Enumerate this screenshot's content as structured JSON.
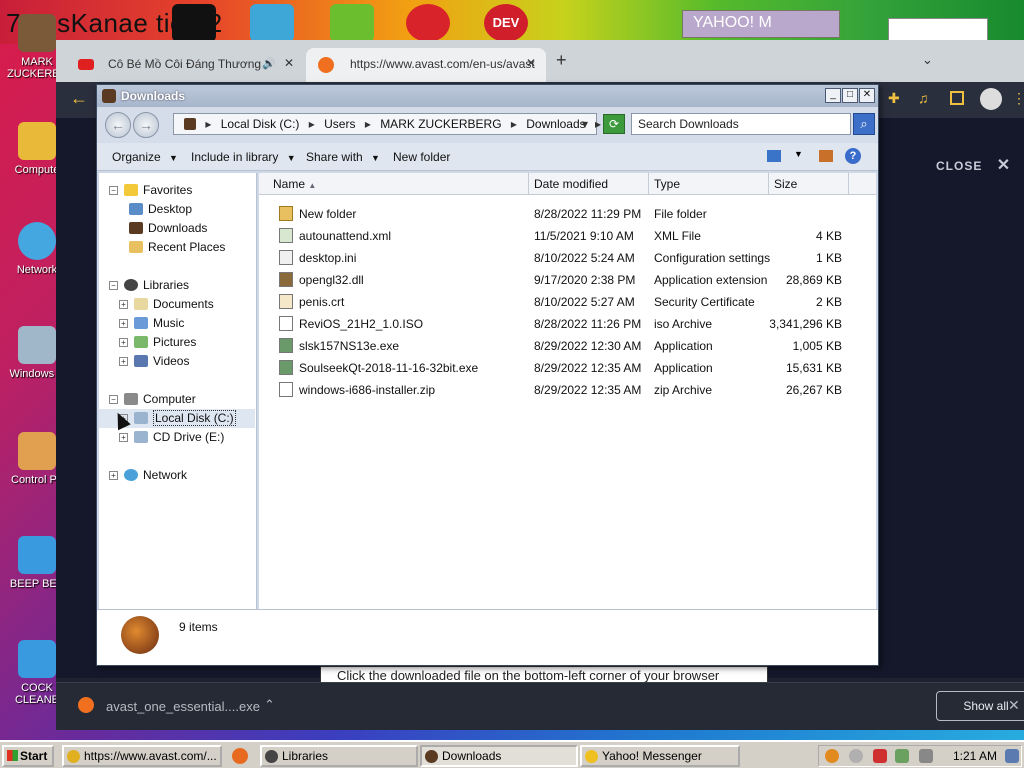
{
  "wallpaper": {
    "title_text": "7 ossKanae tio 12",
    "top_window_label": "YAHOO! M"
  },
  "desktop_icons": [
    {
      "label": "MARK ZUCKERBE"
    },
    {
      "label": "Compute"
    },
    {
      "label": "Network"
    },
    {
      "label": "Windows V"
    },
    {
      "label": "Control Pa"
    },
    {
      "label": "BEEP BEE"
    },
    {
      "label": "COCK CLEANE"
    }
  ],
  "browser": {
    "tabs": [
      {
        "label": "Cô Bé Mồ Côi Đáng Thương"
      },
      {
        "label": "https://www.avast.com/en-us/avast"
      }
    ],
    "close_label": "CLOSE",
    "page_message": "Click the downloaded file on the bottom-left corner of your browser",
    "download_item": "avast_one_essential....exe",
    "show_all": "Show all"
  },
  "explorer": {
    "title": "Downloads",
    "breadcrumb": [
      "Local Disk (C:)",
      "Users",
      "MARK ZUCKERBERG",
      "Downloads"
    ],
    "search_placeholder": "Search Downloads",
    "commands": {
      "organize": "Organize",
      "include_in_library": "Include in library",
      "share_with": "Share with",
      "new_folder": "New folder"
    },
    "nav_tree": {
      "favorites": {
        "label": "Favorites",
        "items": [
          "Desktop",
          "Downloads",
          "Recent Places"
        ]
      },
      "libraries": {
        "label": "Libraries",
        "items": [
          "Documents",
          "Music",
          "Pictures",
          "Videos"
        ]
      },
      "computer": {
        "label": "Computer",
        "items": [
          "Local Disk (C:)",
          "CD Drive (E:)"
        ]
      },
      "network": {
        "label": "Network"
      }
    },
    "columns": [
      "Name",
      "Date modified",
      "Type",
      "Size"
    ],
    "files": [
      {
        "name": "New folder",
        "date": "8/28/2022 11:29 PM",
        "type": "File folder",
        "size": ""
      },
      {
        "name": "autounattend.xml",
        "date": "11/5/2021 9:10 AM",
        "type": "XML File",
        "size": "4 KB"
      },
      {
        "name": "desktop.ini",
        "date": "8/10/2022 5:24 AM",
        "type": "Configuration settings",
        "size": "1 KB"
      },
      {
        "name": "opengl32.dll",
        "date": "9/17/2020 2:38 PM",
        "type": "Application extension",
        "size": "28,869 KB"
      },
      {
        "name": "penis.crt",
        "date": "8/10/2022 5:27 AM",
        "type": "Security Certificate",
        "size": "2 KB"
      },
      {
        "name": "ReviOS_21H2_1.0.ISO",
        "date": "8/28/2022 11:26 PM",
        "type": "iso Archive",
        "size": "3,341,296 KB"
      },
      {
        "name": "slsk157NS13e.exe",
        "date": "8/29/2022 12:30 AM",
        "type": "Application",
        "size": "1,005 KB"
      },
      {
        "name": "SoulseekQt-2018-11-16-32bit.exe",
        "date": "8/29/2022 12:35 AM",
        "type": "Application",
        "size": "15,631 KB"
      },
      {
        "name": "windows-i686-installer.zip",
        "date": "8/29/2022 12:35 AM",
        "type": "zip Archive",
        "size": "26,267 KB"
      }
    ],
    "status": "9 items"
  },
  "taskbar": {
    "start": "Start",
    "tasks": [
      {
        "label": "https://www.avast.com/..."
      },
      {
        "label": "Libraries"
      },
      {
        "label": "Downloads"
      },
      {
        "label": "Yahoo! Messenger"
      }
    ],
    "clock": "1:21 AM"
  }
}
